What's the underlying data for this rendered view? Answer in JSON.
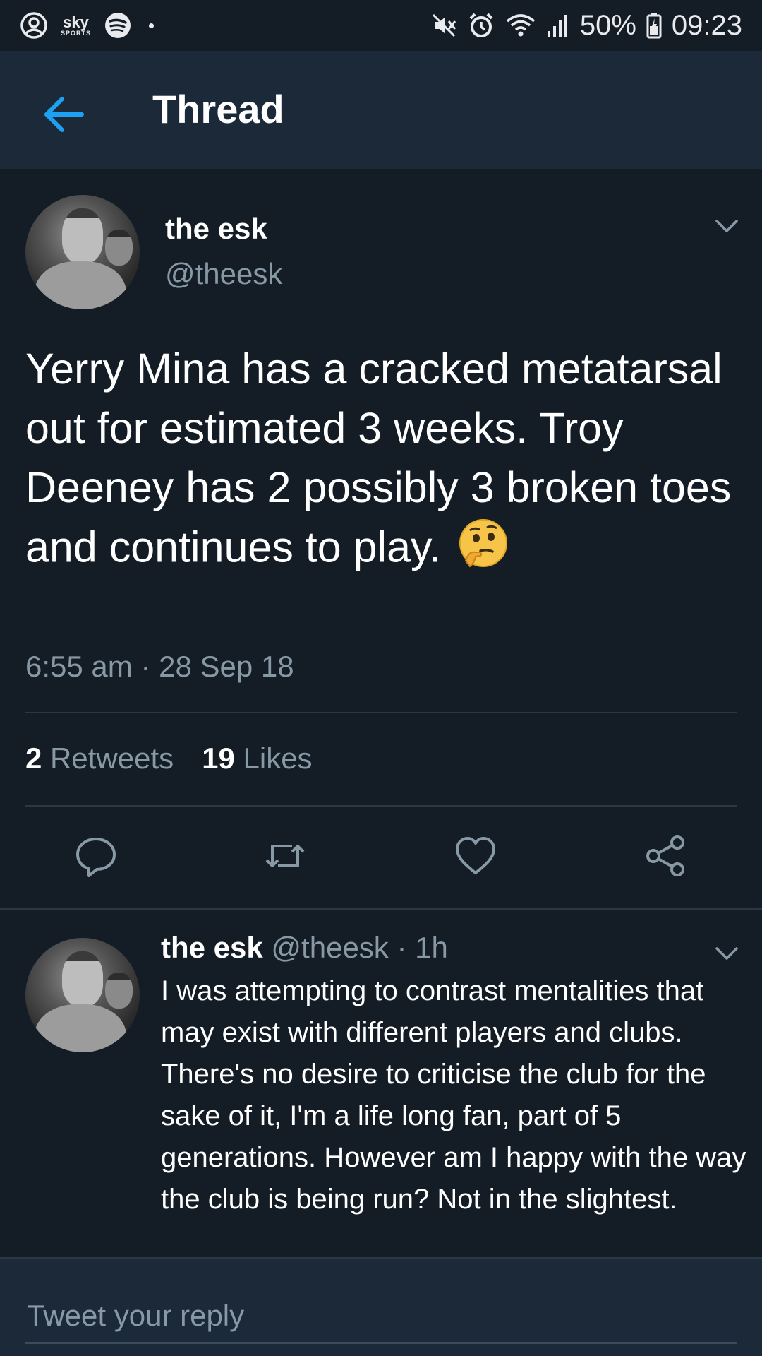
{
  "status_bar": {
    "left_icons": [
      "account-circle-icon",
      "sky-sports-icon",
      "spotify-icon",
      "notification-dot"
    ],
    "sky_top": "sky",
    "sky_bottom": "SPORTS",
    "battery": "50%",
    "time": "09:23",
    "right_icons": [
      "mute-icon",
      "alarm-icon",
      "wifi-icon",
      "signal-icon",
      "battery-icon"
    ]
  },
  "header": {
    "title": "Thread",
    "back_icon": "arrow-left-icon"
  },
  "tweet": {
    "name": "the esk",
    "handle": "@theesk",
    "text": "Yerry Mina has a cracked metatarsal out for estimated 3 weeks. Troy Deeney has 2 possibly 3 broken toes and continues to play.",
    "emoji": "thinking-face-emoji",
    "timestamp": "6:55 am · 28 Sep 18",
    "retweets_count": "2",
    "retweets_label": "Retweets",
    "likes_count": "19",
    "likes_label": "Likes",
    "actions": [
      "reply-icon",
      "retweet-icon",
      "like-icon",
      "share-icon"
    ]
  },
  "reply": {
    "name": "the esk",
    "handle": "@theesk",
    "time": "· 1h",
    "text": "I was attempting to contrast mentalities that may exist with different players and clubs. There's no desire to criticise the club for the sake of it, I'm a life long fan, part of 5 generations. However am I happy with the way the club is being run? Not in the slightest."
  },
  "compose": {
    "placeholder": "Tweet your reply"
  },
  "colors": {
    "background": "#141d26",
    "header": "#1c2938",
    "accent": "#1da1f2",
    "secondary_text": "#8899a6"
  }
}
